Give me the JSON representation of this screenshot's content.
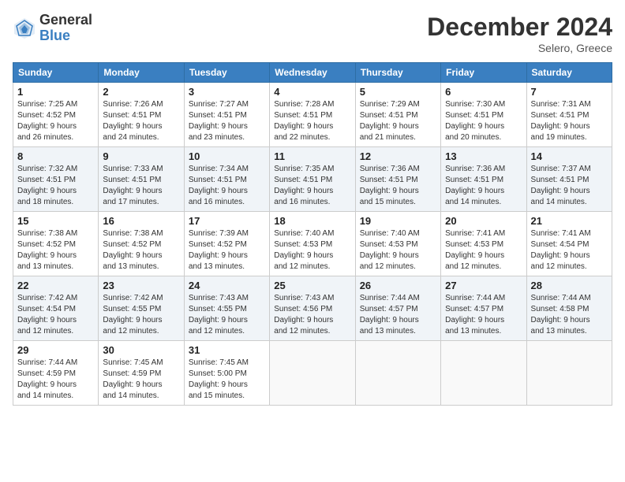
{
  "header": {
    "logo_general": "General",
    "logo_blue": "Blue",
    "month_title": "December 2024",
    "location": "Selero, Greece"
  },
  "days_of_week": [
    "Sunday",
    "Monday",
    "Tuesday",
    "Wednesday",
    "Thursday",
    "Friday",
    "Saturday"
  ],
  "weeks": [
    [
      {
        "day": "1",
        "info": "Sunrise: 7:25 AM\nSunset: 4:52 PM\nDaylight: 9 hours\nand 26 minutes."
      },
      {
        "day": "2",
        "info": "Sunrise: 7:26 AM\nSunset: 4:51 PM\nDaylight: 9 hours\nand 24 minutes."
      },
      {
        "day": "3",
        "info": "Sunrise: 7:27 AM\nSunset: 4:51 PM\nDaylight: 9 hours\nand 23 minutes."
      },
      {
        "day": "4",
        "info": "Sunrise: 7:28 AM\nSunset: 4:51 PM\nDaylight: 9 hours\nand 22 minutes."
      },
      {
        "day": "5",
        "info": "Sunrise: 7:29 AM\nSunset: 4:51 PM\nDaylight: 9 hours\nand 21 minutes."
      },
      {
        "day": "6",
        "info": "Sunrise: 7:30 AM\nSunset: 4:51 PM\nDaylight: 9 hours\nand 20 minutes."
      },
      {
        "day": "7",
        "info": "Sunrise: 7:31 AM\nSunset: 4:51 PM\nDaylight: 9 hours\nand 19 minutes."
      }
    ],
    [
      {
        "day": "8",
        "info": "Sunrise: 7:32 AM\nSunset: 4:51 PM\nDaylight: 9 hours\nand 18 minutes."
      },
      {
        "day": "9",
        "info": "Sunrise: 7:33 AM\nSunset: 4:51 PM\nDaylight: 9 hours\nand 17 minutes."
      },
      {
        "day": "10",
        "info": "Sunrise: 7:34 AM\nSunset: 4:51 PM\nDaylight: 9 hours\nand 16 minutes."
      },
      {
        "day": "11",
        "info": "Sunrise: 7:35 AM\nSunset: 4:51 PM\nDaylight: 9 hours\nand 16 minutes."
      },
      {
        "day": "12",
        "info": "Sunrise: 7:36 AM\nSunset: 4:51 PM\nDaylight: 9 hours\nand 15 minutes."
      },
      {
        "day": "13",
        "info": "Sunrise: 7:36 AM\nSunset: 4:51 PM\nDaylight: 9 hours\nand 14 minutes."
      },
      {
        "day": "14",
        "info": "Sunrise: 7:37 AM\nSunset: 4:51 PM\nDaylight: 9 hours\nand 14 minutes."
      }
    ],
    [
      {
        "day": "15",
        "info": "Sunrise: 7:38 AM\nSunset: 4:52 PM\nDaylight: 9 hours\nand 13 minutes."
      },
      {
        "day": "16",
        "info": "Sunrise: 7:38 AM\nSunset: 4:52 PM\nDaylight: 9 hours\nand 13 minutes."
      },
      {
        "day": "17",
        "info": "Sunrise: 7:39 AM\nSunset: 4:52 PM\nDaylight: 9 hours\nand 13 minutes."
      },
      {
        "day": "18",
        "info": "Sunrise: 7:40 AM\nSunset: 4:53 PM\nDaylight: 9 hours\nand 12 minutes."
      },
      {
        "day": "19",
        "info": "Sunrise: 7:40 AM\nSunset: 4:53 PM\nDaylight: 9 hours\nand 12 minutes."
      },
      {
        "day": "20",
        "info": "Sunrise: 7:41 AM\nSunset: 4:53 PM\nDaylight: 9 hours\nand 12 minutes."
      },
      {
        "day": "21",
        "info": "Sunrise: 7:41 AM\nSunset: 4:54 PM\nDaylight: 9 hours\nand 12 minutes."
      }
    ],
    [
      {
        "day": "22",
        "info": "Sunrise: 7:42 AM\nSunset: 4:54 PM\nDaylight: 9 hours\nand 12 minutes."
      },
      {
        "day": "23",
        "info": "Sunrise: 7:42 AM\nSunset: 4:55 PM\nDaylight: 9 hours\nand 12 minutes."
      },
      {
        "day": "24",
        "info": "Sunrise: 7:43 AM\nSunset: 4:55 PM\nDaylight: 9 hours\nand 12 minutes."
      },
      {
        "day": "25",
        "info": "Sunrise: 7:43 AM\nSunset: 4:56 PM\nDaylight: 9 hours\nand 12 minutes."
      },
      {
        "day": "26",
        "info": "Sunrise: 7:44 AM\nSunset: 4:57 PM\nDaylight: 9 hours\nand 13 minutes."
      },
      {
        "day": "27",
        "info": "Sunrise: 7:44 AM\nSunset: 4:57 PM\nDaylight: 9 hours\nand 13 minutes."
      },
      {
        "day": "28",
        "info": "Sunrise: 7:44 AM\nSunset: 4:58 PM\nDaylight: 9 hours\nand 13 minutes."
      }
    ],
    [
      {
        "day": "29",
        "info": "Sunrise: 7:44 AM\nSunset: 4:59 PM\nDaylight: 9 hours\nand 14 minutes."
      },
      {
        "day": "30",
        "info": "Sunrise: 7:45 AM\nSunset: 4:59 PM\nDaylight: 9 hours\nand 14 minutes."
      },
      {
        "day": "31",
        "info": "Sunrise: 7:45 AM\nSunset: 5:00 PM\nDaylight: 9 hours\nand 15 minutes."
      },
      {
        "day": "",
        "info": ""
      },
      {
        "day": "",
        "info": ""
      },
      {
        "day": "",
        "info": ""
      },
      {
        "day": "",
        "info": ""
      }
    ]
  ]
}
